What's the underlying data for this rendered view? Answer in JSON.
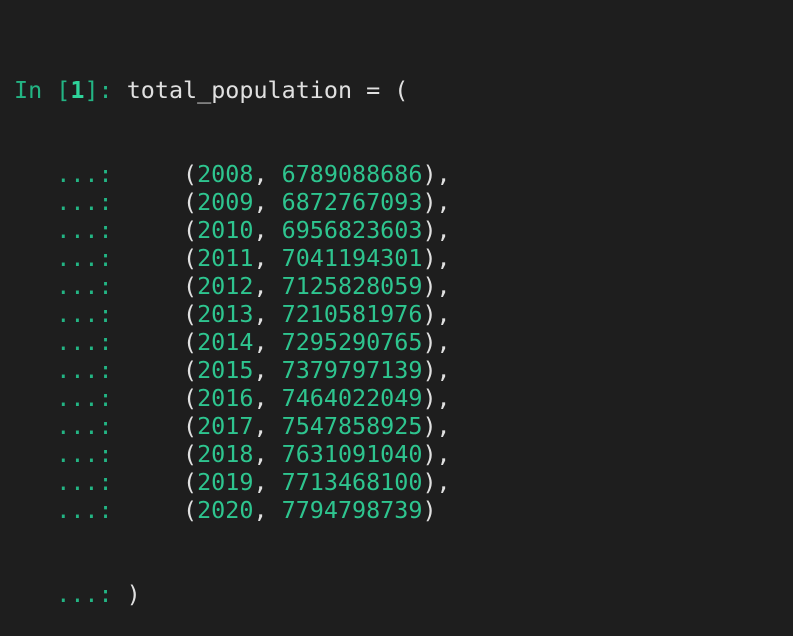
{
  "prompt": {
    "in_label": "In",
    "open_bracket": "[",
    "number": "1",
    "close_bracket": "]:",
    "continuation": "...:"
  },
  "code": {
    "first_line": " total_population = (",
    "last_line": " )",
    "rows": [
      {
        "year": "2008",
        "population": "6789088686",
        "trail": "),"
      },
      {
        "year": "2009",
        "population": "6872767093",
        "trail": "),"
      },
      {
        "year": "2010",
        "population": "6956823603",
        "trail": "),"
      },
      {
        "year": "2011",
        "population": "7041194301",
        "trail": "),"
      },
      {
        "year": "2012",
        "population": "7125828059",
        "trail": "),"
      },
      {
        "year": "2013",
        "population": "7210581976",
        "trail": "),"
      },
      {
        "year": "2014",
        "population": "7295290765",
        "trail": "),"
      },
      {
        "year": "2015",
        "population": "7379797139",
        "trail": "),"
      },
      {
        "year": "2016",
        "population": "7464022049",
        "trail": "),"
      },
      {
        "year": "2017",
        "population": "7547858925",
        "trail": "),"
      },
      {
        "year": "2018",
        "population": "7631091040",
        "trail": "),"
      },
      {
        "year": "2019",
        "population": "7713468100",
        "trail": "),"
      },
      {
        "year": "2020",
        "population": "7794798739",
        "trail": ")"
      }
    ]
  },
  "colors": {
    "background": "#1e1e1e",
    "prompt": "#23b584",
    "number": "#2ec58f",
    "text": "#e0e0e0"
  }
}
